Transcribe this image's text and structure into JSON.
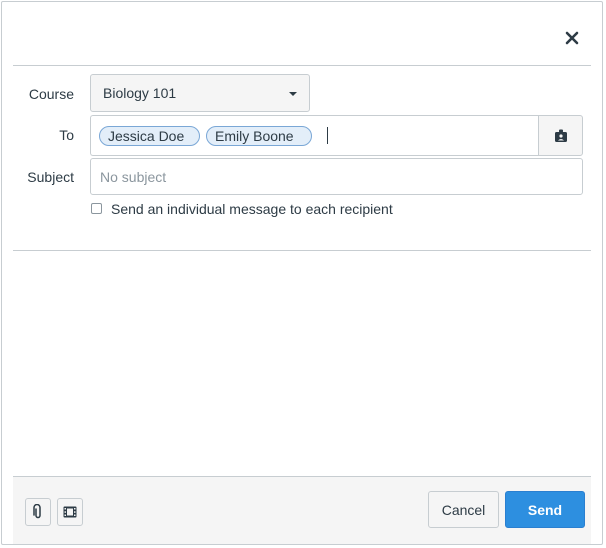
{
  "form": {
    "course_label": "Course",
    "course_value": "Biology 101",
    "to_label": "To",
    "recipients": [
      "Jessica Doe",
      "Emily Boone"
    ],
    "subject_label": "Subject",
    "subject_placeholder": "No subject",
    "individual_message_label": "Send an individual message to each recipient",
    "individual_message_checked": false
  },
  "footer": {
    "cancel_label": "Cancel",
    "send_label": "Send"
  },
  "icons": {
    "close": "close-icon",
    "address_book": "address-book-icon",
    "attachment": "paperclip-icon",
    "media": "media-icon"
  },
  "colors": {
    "accent": "#2d8fe0",
    "token_bg": "#e3eef9",
    "token_border": "#7aa7d6",
    "border": "#c7cdd1"
  }
}
